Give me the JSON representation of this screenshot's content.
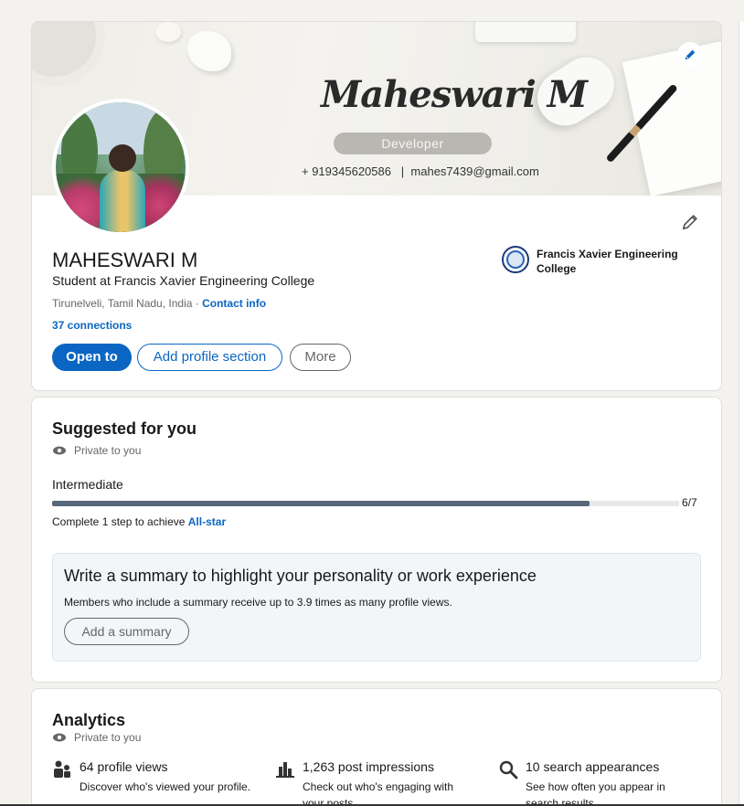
{
  "profile": {
    "banner": {
      "name": "Maheswari M",
      "role": "Developer",
      "contact": "+ 919345620586   |  mahes7439@gmail.com"
    },
    "name": "MAHESWARI M",
    "headline": "Student at Francis Xavier Engineering College",
    "location": "Tirunelveli, Tamil Nadu, India",
    "location_separator": " · ",
    "contact_info": "Contact info",
    "connections": "37 connections",
    "buttons": {
      "open_to": "Open to",
      "add_section": "Add profile section",
      "more": "More"
    },
    "school": "Francis Xavier Engineering College"
  },
  "suggested": {
    "title": "Suggested for you",
    "private": "Private to you",
    "level": "Intermediate",
    "progress": {
      "current": 6,
      "total": 7,
      "label": "6/7"
    },
    "complete_prefix": "Complete 1 step to achieve ",
    "complete_link": "All-star",
    "summary_title": "Write a summary to highlight your personality or work experience",
    "summary_text": "Members who include a summary receive up to 3.9 times as many profile views.",
    "summary_button": "Add a summary"
  },
  "analytics": {
    "title": "Analytics",
    "private": "Private to you",
    "stats": [
      {
        "icon": "people-icon",
        "title": "64 profile views",
        "desc": "Discover who's viewed your profile."
      },
      {
        "icon": "bar-chart-icon",
        "title": "1,263 post impressions",
        "desc": "Check out who's engaging with your posts."
      },
      {
        "icon": "search-icon",
        "title": "10 search appearances",
        "desc": "See how often you appear in search results."
      }
    ]
  },
  "colors": {
    "accent": "#0a66c2",
    "progress": "#56687a",
    "background": "#f4f2ee"
  }
}
